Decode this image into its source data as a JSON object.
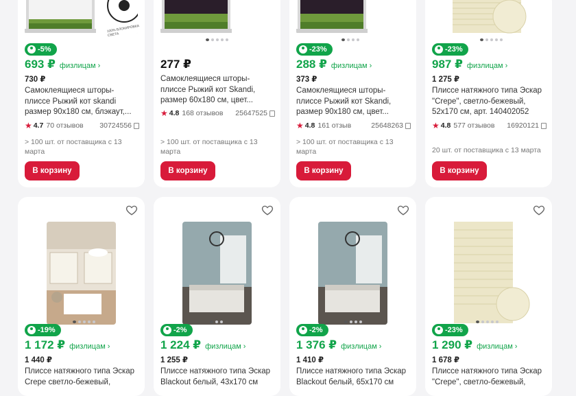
{
  "row1": [
    {
      "badge": "-5%",
      "price": "693 ₽",
      "fiz": "физлицам ›",
      "old": "730 ₽",
      "title": "Самоклеящиеся шторы-плиссе Рыжий кот skandi размер 90х180 см, блэкаут,...",
      "rating": "4.7",
      "reviews": "70 отзывов",
      "article": "30724556",
      "supply": "> 100 шт. от поставщика с 13 марта",
      "cart": "В корзину"
    },
    {
      "badge": "",
      "price": "277 ₽",
      "fiz": "",
      "old": "",
      "title": "Самоклеящиеся шторы-плиссе Рыжий кот Skandi, размер 60х180 см, цвет...",
      "rating": "4.8",
      "reviews": "168 отзывов",
      "article": "25647525",
      "supply": "> 100 шт. от поставщика с 13 марта",
      "cart": "В корзину"
    },
    {
      "badge": "-23%",
      "price": "288 ₽",
      "fiz": "физлицам ›",
      "old": "373 ₽",
      "title": "Самоклеящиеся шторы-плиссе Рыжий кот Skandi, размер 90х180 см, цвет...",
      "rating": "4.8",
      "reviews": "161 отзыв",
      "article": "25648263",
      "supply": "> 100 шт. от поставщика с 13 марта",
      "cart": "В корзину"
    },
    {
      "badge": "-23%",
      "price": "987 ₽",
      "fiz": "физлицам ›",
      "old": "1 275 ₽",
      "title": "Плиссе натяжного типа Эскар \"Crepe\", светло-бежевый, 52х170 см, арт. 140402052",
      "rating": "4.8",
      "reviews": "577 отзывов",
      "article": "16920121",
      "supply": "20 шт. от поставщика с 13 марта",
      "cart": "В корзину"
    }
  ],
  "row1_stamp": "100% БЛОКИРОВКА СВЕТА",
  "row2": [
    {
      "badge": "-19%",
      "price": "1 172 ₽",
      "fiz": "физлицам ›",
      "old": "1 440 ₽",
      "title": "Плиссе натяжного типа Эскар Crepe светло-бежевый,"
    },
    {
      "badge": "-2%",
      "price": "1 224 ₽",
      "fiz": "физлицам ›",
      "old": "1 255 ₽",
      "title": "Плиссе натяжного типа Эскар Blackout белый, 43х170 см"
    },
    {
      "badge": "-2%",
      "price": "1 376 ₽",
      "fiz": "физлицам ›",
      "old": "1 410 ₽",
      "title": "Плиссе натяжного типа Эскар Blackout белый, 65х170 см"
    },
    {
      "badge": "-23%",
      "price": "1 290 ₽",
      "fiz": "физлицам ›",
      "old": "1 678 ₽",
      "title": "Плиссе натяжного типа Эскар \"Crepe\", светло-бежевый,"
    }
  ],
  "colors": {
    "accent_green": "#11a44a",
    "cart_red": "#d81b3a",
    "rating_star": "#d81b3a"
  },
  "icons": {
    "wishlist": "heart-icon",
    "rating": "star-icon",
    "copy": "copy-icon",
    "discount": "person-badge-icon"
  }
}
